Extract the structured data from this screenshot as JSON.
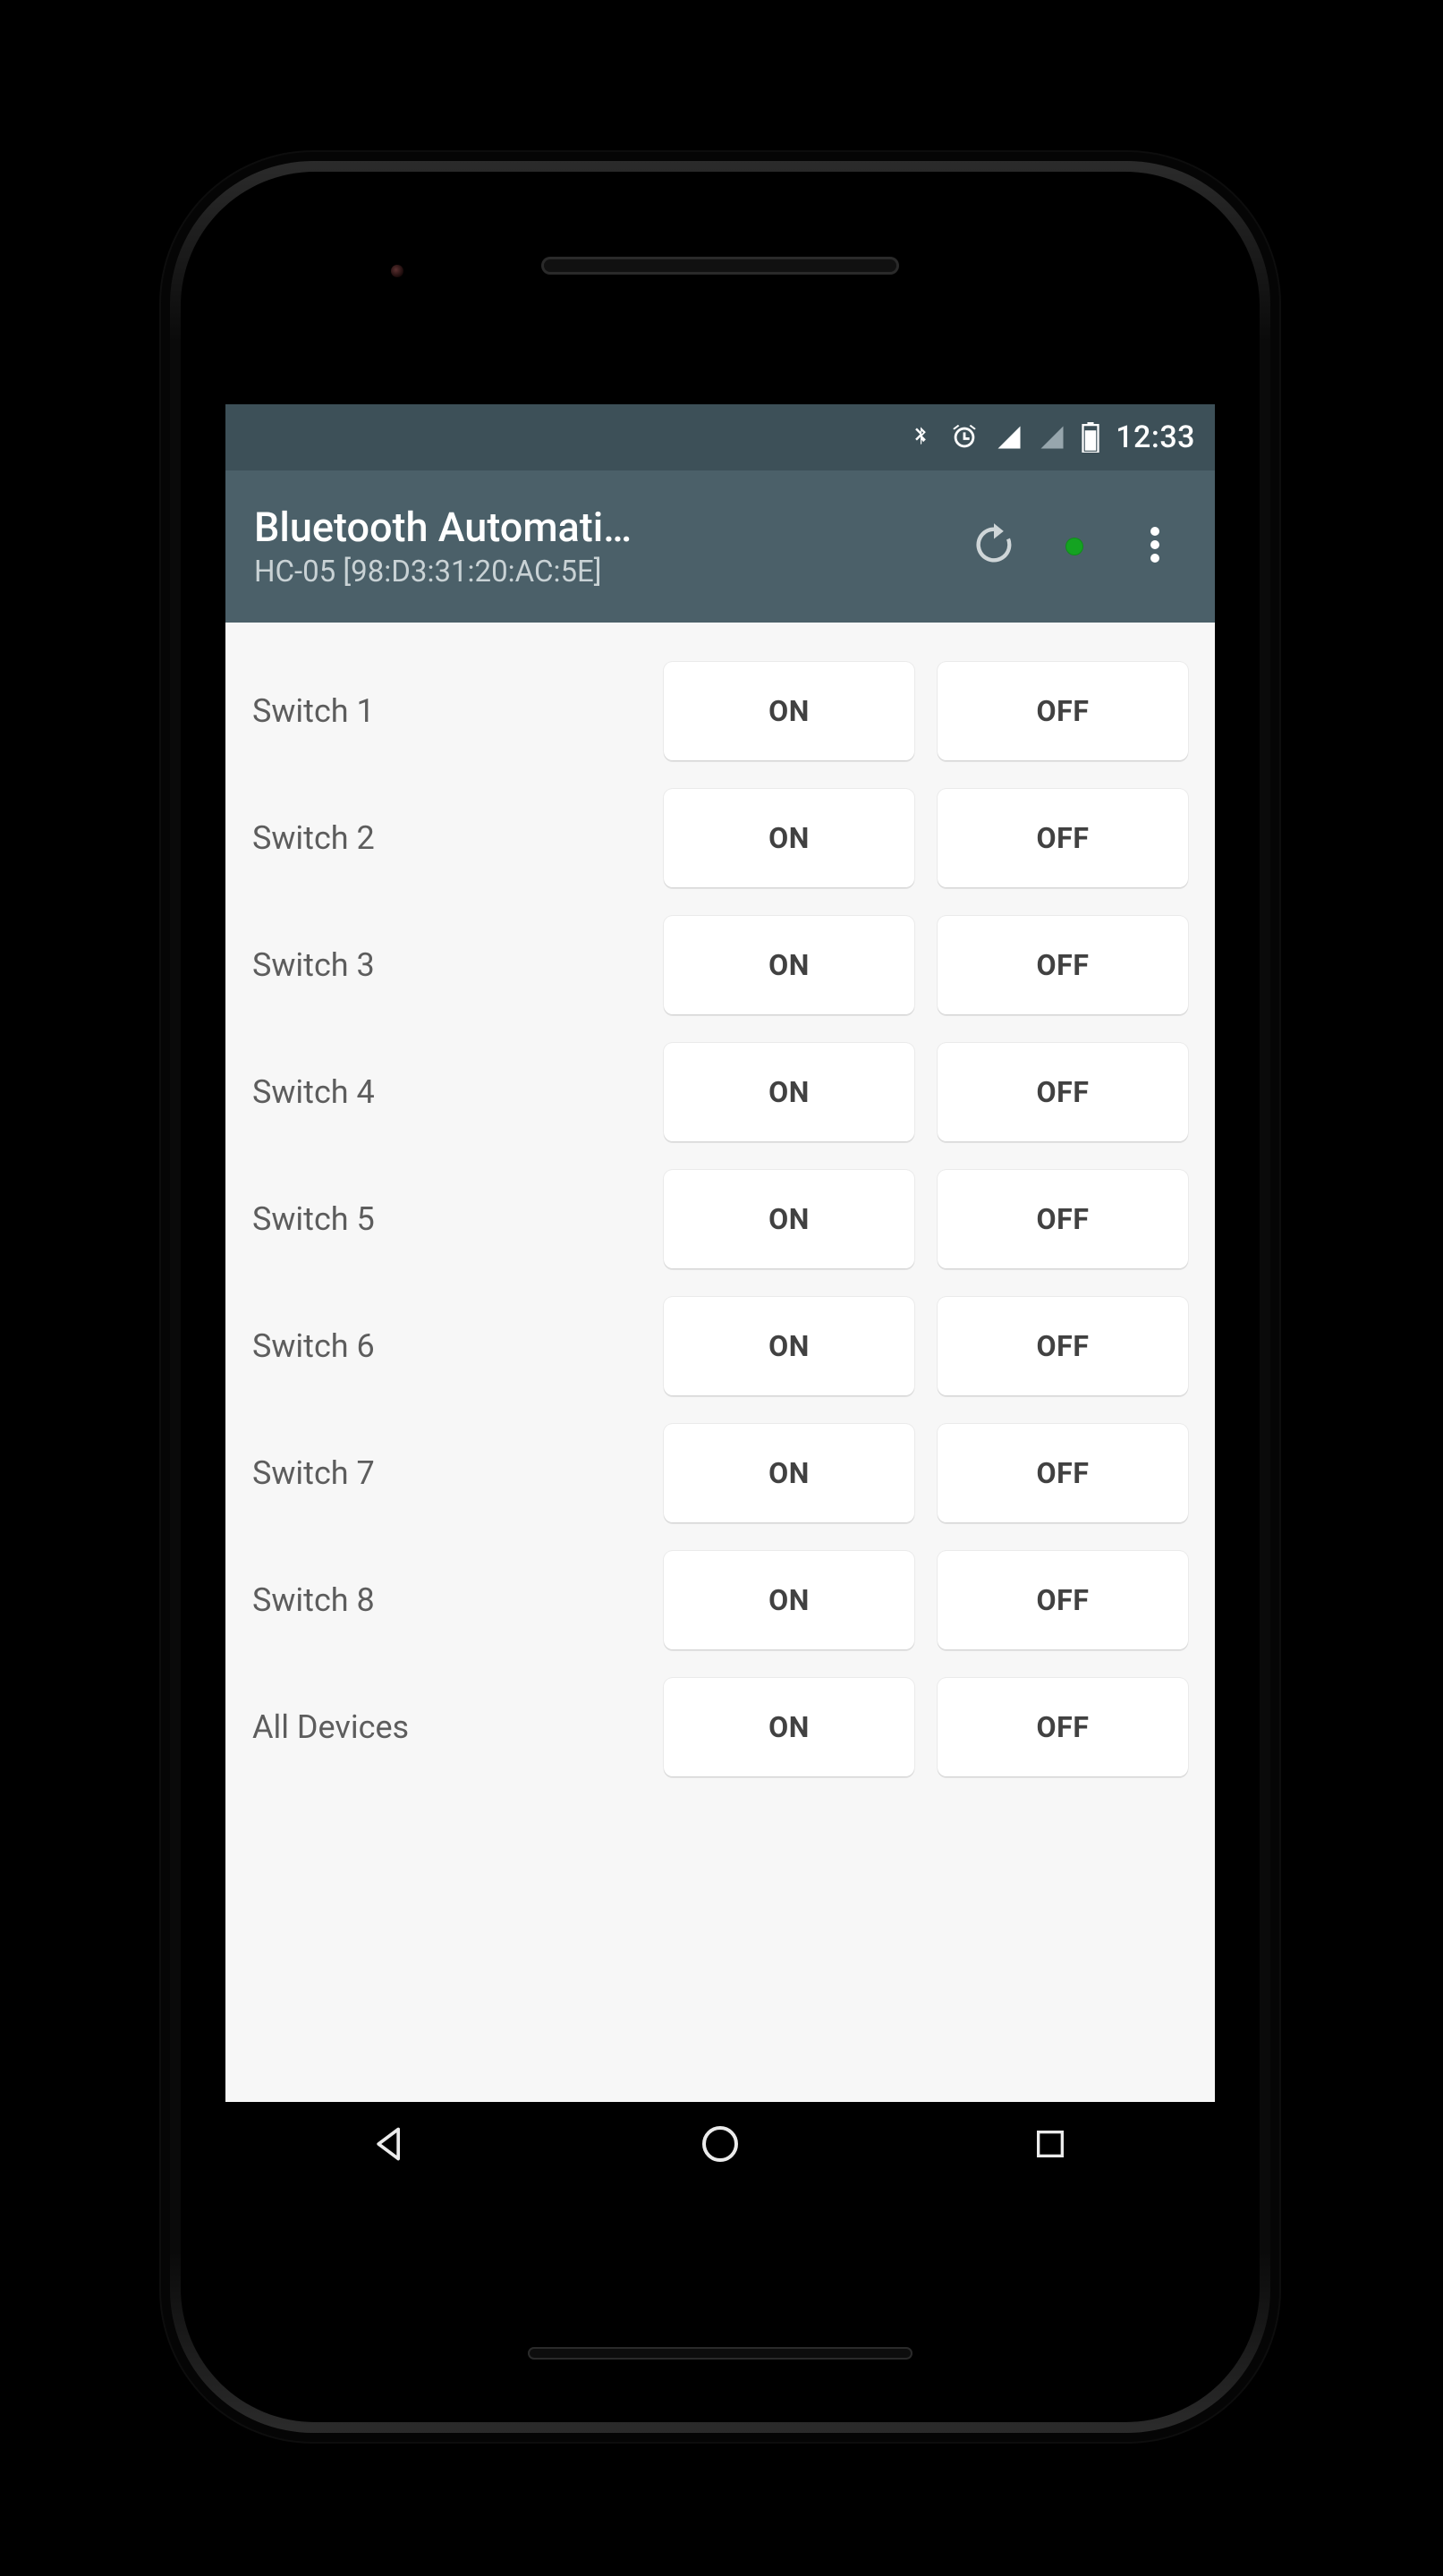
{
  "status_bar": {
    "clock": "12:33"
  },
  "app_bar": {
    "title": "Bluetooth Automati…",
    "subtitle": "HC-05 [98:D3:31:20:AC:5E]"
  },
  "buttons": {
    "on": "ON",
    "off": "OFF"
  },
  "rows": [
    {
      "label": "Switch 1"
    },
    {
      "label": "Switch 2"
    },
    {
      "label": "Switch 3"
    },
    {
      "label": "Switch 4"
    },
    {
      "label": "Switch 5"
    },
    {
      "label": "Switch 6"
    },
    {
      "label": "Switch 7"
    },
    {
      "label": "Switch 8"
    },
    {
      "label": "All Devices"
    }
  ]
}
